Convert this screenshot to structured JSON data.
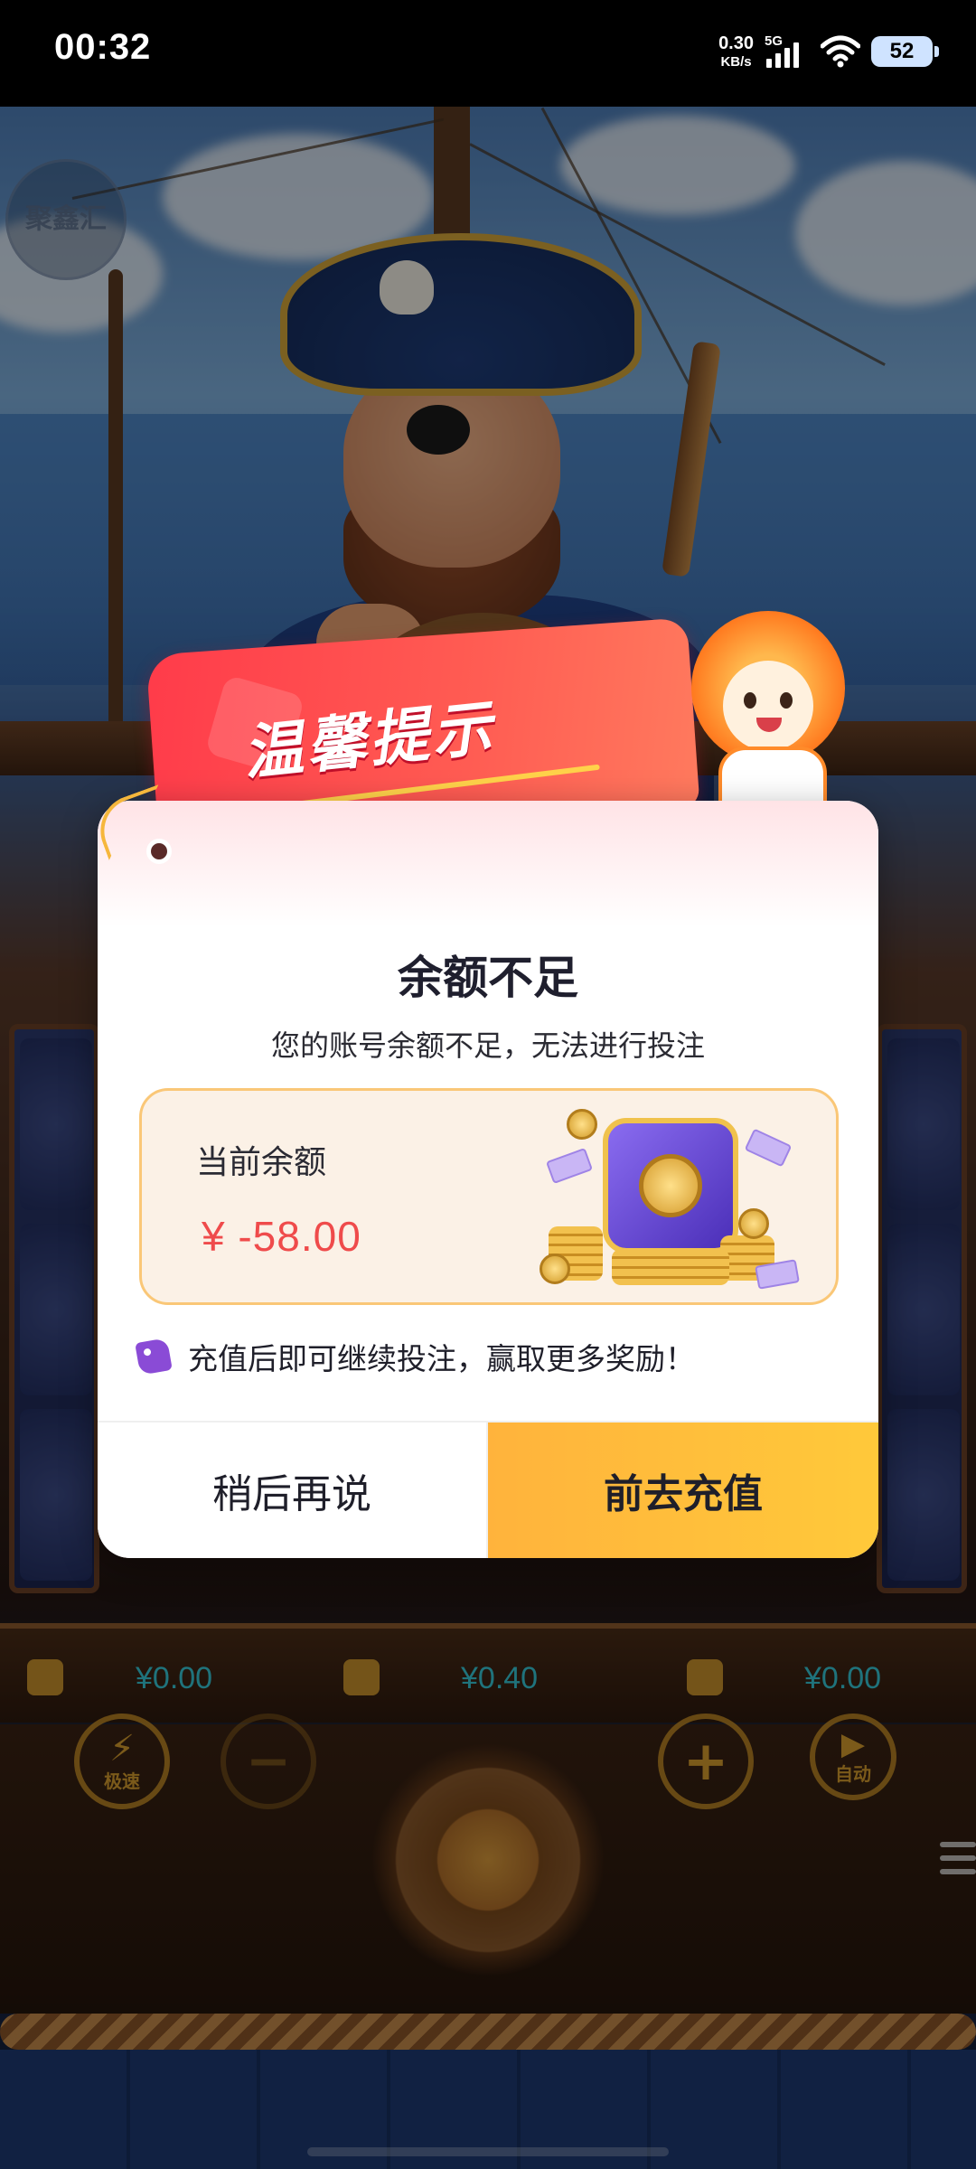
{
  "status_bar": {
    "time": "00:32",
    "net_speed_value": "0.30",
    "net_speed_unit": "KB/s",
    "network_type": "5G",
    "battery": "52"
  },
  "game": {
    "watermark_text": "聚鑫汇",
    "balance_bar": [
      "¥0.00",
      "¥0.40",
      "¥0.00"
    ],
    "turbo_label": "极速",
    "auto_label": "自动"
  },
  "dialog": {
    "ribbon_title": "温馨提示",
    "title": "余额不足",
    "subtitle": "您的账号余额不足，无法进行投注",
    "balance_label": "当前余额",
    "balance_value": "¥ -58.00",
    "tip": "充值后即可继续投注，赢取更多奖励！",
    "cancel_label": "稍后再说",
    "confirm_label": "前去充值"
  },
  "colors": {
    "accent_red": "#ff3b4a",
    "confirm_yellow": "#ffc93a",
    "balance_red": "#ef4b4b",
    "tip_purple": "#8a4bd6"
  }
}
